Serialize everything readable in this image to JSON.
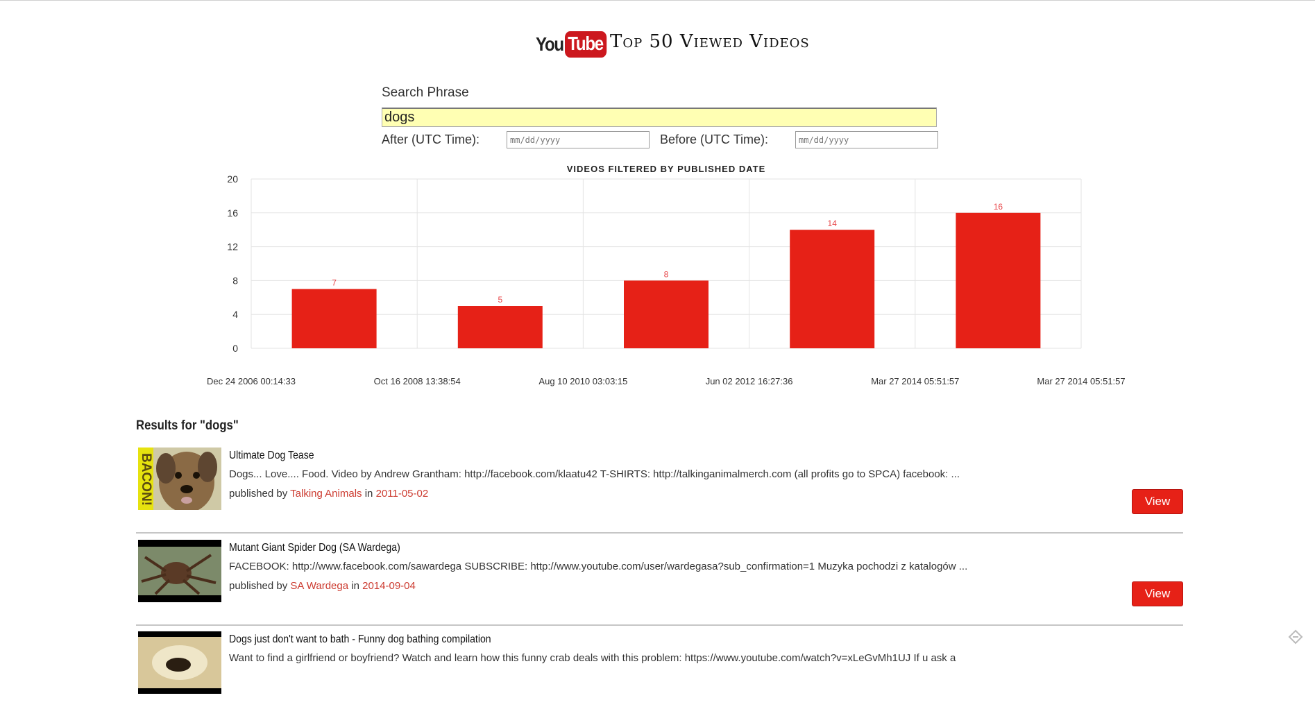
{
  "header": {
    "logo_you": "You",
    "logo_tube": "Tube",
    "title": "Top 50 Viewed Videos"
  },
  "search": {
    "phrase_label": "Search Phrase",
    "phrase_value": "dogs",
    "after_label": "After (UTC Time):",
    "after_placeholder": "mm/dd/yyyy",
    "before_label": "Before (UTC Time):",
    "before_placeholder": "mm/dd/yyyy"
  },
  "chart_data": {
    "type": "bar",
    "title": "VIDEOS FILTERED BY PUBLISHED DATE",
    "categories": [
      "Dec 24 2006 00:14:33",
      "Oct 16 2008 13:38:54",
      "Aug 10 2010 03:03:15",
      "Jun 02 2012 16:27:36",
      "Mar 27 2014 05:51:57"
    ],
    "x_tick_labels": [
      "Dec 24 2006 00:14:33",
      "Oct 16 2008 13:38:54",
      "Aug 10 2010 03:03:15",
      "Jun 02 2012 16:27:36",
      "Mar 27 2014 05:51:57",
      "Mar 27 2014 05:51:57"
    ],
    "values": [
      7,
      5,
      8,
      14,
      16
    ],
    "y_ticks": [
      0,
      4,
      8,
      12,
      16,
      20
    ],
    "ylim": [
      0,
      20
    ],
    "xlabel": "",
    "ylabel": "",
    "grid": true,
    "bar_color": "#e62117",
    "label_color": "#e8474a"
  },
  "results": {
    "heading": "Results for \"dogs\"",
    "published_by": "published by",
    "in_word": "in",
    "view_label": "View",
    "items": [
      {
        "title": "Ultimate Dog Tease",
        "description": "Dogs... Love.... Food. Video by Andrew Grantham: http://facebook.com/klaatu42 T-SHIRTS: http://talkinganimalmerch.com (all profits go to SPCA) facebook: ...",
        "channel": "Talking Animals",
        "date": "2011-05-02",
        "thumb_text": "BACON!"
      },
      {
        "title": "Mutant Giant Spider Dog (SA Wardega)",
        "description": "FACEBOOK: http://www.facebook.com/sawardega SUBSCRIBE: http://www.youtube.com/user/wardegasa?sub_confirmation=1 Muzyka pochodzi z katalogów ...",
        "channel": "SA Wardega",
        "date": "2014-09-04"
      },
      {
        "title": "Dogs just don't want to bath - Funny dog bathing compilation",
        "description": "Want to find a girlfriend or boyfriend? Watch and learn how this funny crab deals with this problem: https://www.youtube.com/watch?v=xLeGvMh1UJ If u ask a"
      }
    ]
  },
  "colors": {
    "accent": "#e62117",
    "link": "#cc3b30",
    "search_bg": "#ffffb3"
  }
}
